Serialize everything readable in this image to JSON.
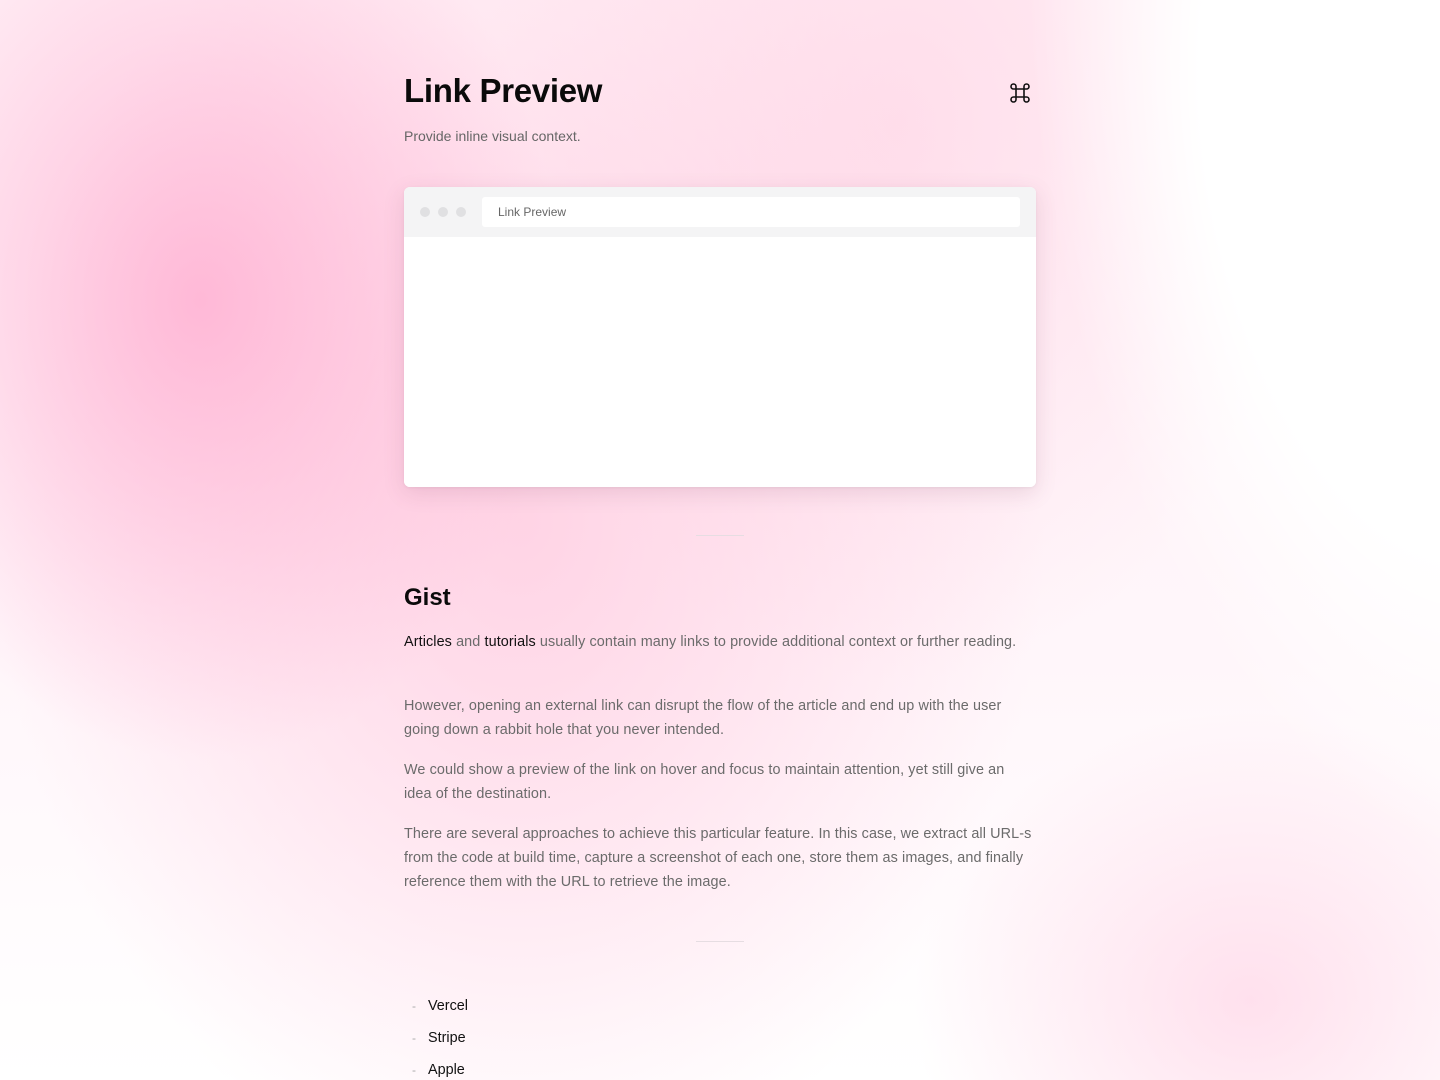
{
  "header": {
    "title": "Link Preview",
    "subtitle": "Provide inline visual context.",
    "command_icon": "command-icon"
  },
  "browser": {
    "address_text": "Link Preview"
  },
  "gist": {
    "heading": "Gist",
    "p1": {
      "link1": "Articles",
      "and": " and ",
      "link2": "tutorials",
      "rest": " usually contain many links to provide additional context or further reading."
    },
    "p2": "However, opening an external link can disrupt the flow of the article and end up with the user going down a rabbit hole that you never intended.",
    "p3": "We could show a preview of the link on hover and focus to maintain attention, yet still give an idea of the destination.",
    "p4": "There are several approaches to achieve this particular feature. In this case, we extract all URL-s from the code at build time, capture a screenshot of each one, store them as images, and finally reference them with the URL to retrieve the image."
  },
  "links": {
    "bullet": "-",
    "items": [
      "Vercel",
      "Stripe",
      "Apple"
    ]
  }
}
